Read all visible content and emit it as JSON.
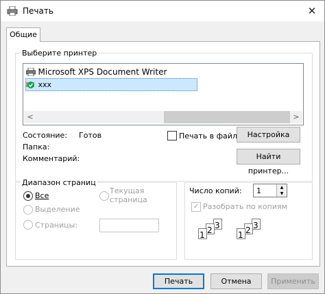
{
  "window": {
    "title": "Печать",
    "close_glyph": "✕"
  },
  "tabs": [
    "Общие"
  ],
  "printer_group": {
    "label": "Выберите принтер",
    "printers": [
      "Microsoft XPS Document Writer",
      "xxx"
    ],
    "selected_index": 1
  },
  "status": {
    "state_label": "Состояние:",
    "state_value": "Готов",
    "folder_label": "Папка:",
    "folder_value": "",
    "comment_label": "Комментарий:",
    "comment_value": ""
  },
  "print_to_file_label": "Печать в файл",
  "buttons": {
    "settings": "Настройка",
    "find_printer": "Найти принтер...",
    "print": "Печать",
    "cancel": "Отмена",
    "apply": "Применить"
  },
  "range_group": {
    "label": "Диапазон страниц",
    "all": "Все",
    "current_line1": "Текущая",
    "current_line2": "страница",
    "selection": "Выделение",
    "pages": "Страницы:",
    "pages_value": ""
  },
  "copies": {
    "label": "Число копий:",
    "value": "1",
    "collate_label": "Разобрать по копиям",
    "collate_checked": true,
    "collate_glyph": "✓"
  },
  "collate_icon": {
    "pages": [
      "1",
      "2",
      "3",
      "1",
      "2",
      "3"
    ]
  },
  "scroll_arrows": {
    "left": "<",
    "right": ">",
    "up": "▲",
    "down": "▼"
  }
}
